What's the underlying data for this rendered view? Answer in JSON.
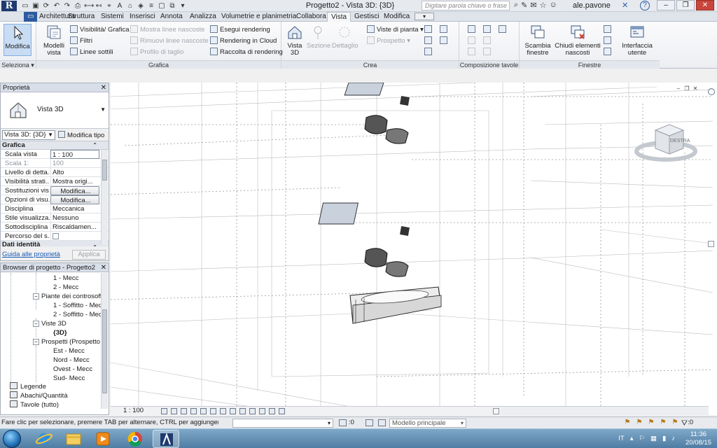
{
  "window": {
    "title": "Progetto2 - Vista 3D: {3D}",
    "search_placeholder": "Digitare parola chiave o frase",
    "user": "ale.pavone",
    "help_label": "?"
  },
  "ribbon_tabs": [
    "Architettura",
    "Struttura",
    "Sistemi",
    "Inserisci",
    "Annota",
    "Analizza",
    "Volumetrie e planimetria",
    "Collabora",
    "Vista",
    "Gestisci",
    "Modifica"
  ],
  "active_tab": "Vista",
  "ribbon": {
    "seleziona": {
      "button": "Modifica",
      "title": "Seleziona"
    },
    "grafica": {
      "title": "Grafica",
      "modelli_vista": "Modelli vista",
      "visibilita": "Visibilità/ Grafica",
      "filtri": "Filtri",
      "linee_sottili": "Linee sottili",
      "mostra_linee": "Mostra linee nascoste",
      "rimuovi_linee": "Rimuovi linee nascoste",
      "profilo_taglio": "Profilo di taglio",
      "esegui_rendering": "Esegui rendering",
      "rendering_cloud": "Rendering in Cloud",
      "raccolta_rendering": "Raccolta di rendering"
    },
    "crea": {
      "title": "Crea",
      "vista_3d": "Vista 3D",
      "sezione": "Sezione",
      "dettaglio": "Dettaglio",
      "viste_pianta": "Viste di pianta",
      "prospetto": "Prospetto"
    },
    "composizione": {
      "title": "Composizione tavole"
    },
    "finestre": {
      "title": "Finestre",
      "scambia": "Scambia finestre",
      "chiudi": "Chiudi elementi nascosti",
      "interfaccia": "Interfaccia utente"
    }
  },
  "properties": {
    "title": "Proprietà",
    "type_name": "Vista 3D",
    "view_selector": "Vista 3D: {3D}",
    "modifica_tipo": "Modifica tipo",
    "group_grafica": "Grafica",
    "rows": [
      {
        "label": "Scala vista",
        "value": "1 : 100"
      },
      {
        "label": "Scala 1:",
        "value": "100"
      },
      {
        "label": "Livello di detta...",
        "value": "Alto"
      },
      {
        "label": "Visibilità strati...",
        "value": "Mostra origi..."
      },
      {
        "label": "Sostituzioni vis...",
        "value": "Modifica..."
      },
      {
        "label": "Opzioni di visu...",
        "value": "Modifica..."
      },
      {
        "label": "Disciplina",
        "value": "Meccanica"
      },
      {
        "label": "Stile visualizza...",
        "value": "Nessuno"
      },
      {
        "label": "Sottodisciplina",
        "value": "Riscaldamen..."
      },
      {
        "label": "Percorso del s...",
        "value": ""
      }
    ],
    "group_identita": "Dati identità",
    "help_link": "Guida alle proprietà",
    "apply": "Applica"
  },
  "browser": {
    "title": "Browser di progetto - Progetto2",
    "items": [
      "1 - Mecc",
      "2 - Mecc",
      "Piante dei controsoffi",
      "1 - Soffitto - Mec",
      "2 - Soffitto - Mec",
      "Viste 3D",
      "{3D}",
      "Prospetti (Prospetto e",
      "Est - Mecc",
      "Nord - Mecc",
      "Ovest - Mecc",
      "Sud- Mecc",
      "Legende",
      "Abachi/Quantità",
      "Tavole (tutto)"
    ]
  },
  "viewcube": {
    "face": "DESTRA"
  },
  "view_bar": {
    "scale": "1 : 100"
  },
  "status": {
    "message": "Fare clic per selezionare, premere TAB per alternare, CTRL per aggiungere e MAIUSC",
    "zero": ":0",
    "model": "Modello principale",
    "zero2": ":0"
  },
  "taskbar": {
    "language": "IT",
    "time": "11:36",
    "date": "20/08/15"
  }
}
